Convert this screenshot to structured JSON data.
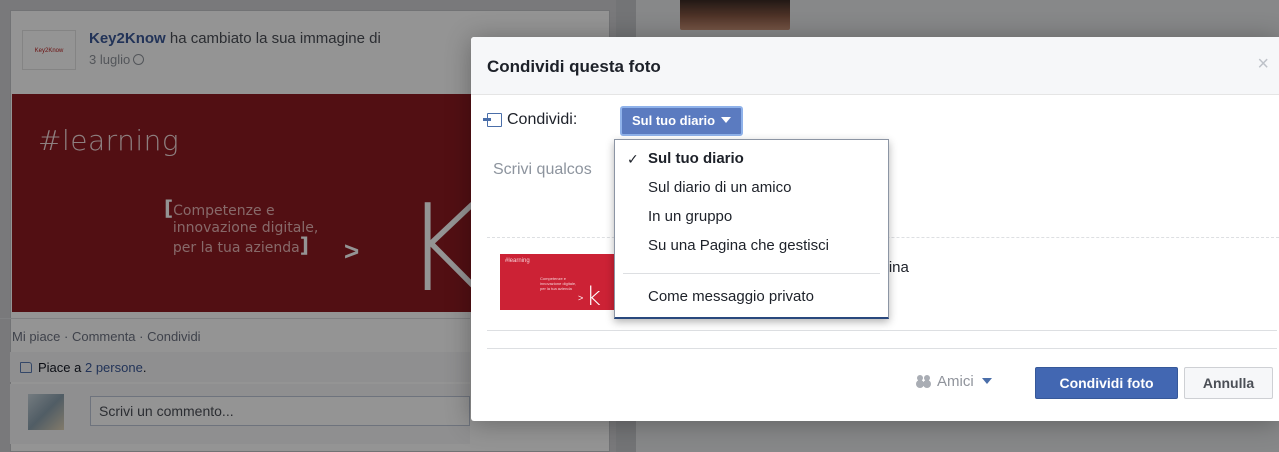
{
  "feed": {
    "page_logo_text": "Key2Know",
    "page_name": "Key2Know",
    "story_action": " ha cambiato la sua immagine di",
    "story_date": "3 luglio",
    "banner_hashtag": "#learning",
    "banner_tagline_line1": "Competenze e",
    "banner_tagline_line2": "innovazione digitale,",
    "banner_tagline_line3": "per la tua azienda",
    "banner_arrow": ">",
    "banner_k": "K",
    "actions_text": "Mi piace · Commenta · Condividi",
    "likes_prefix": "Piace a ",
    "likes_count": "2 persone",
    "likes_suffix": ".",
    "comment_placeholder": "Scrivi un commento..."
  },
  "dialog": {
    "title": "Condividi questa foto",
    "close_symbol": "×",
    "share_label": "Condividi:",
    "target_selected": "Sul tuo diario",
    "message_placeholder": "Scrivi qualcos",
    "preview_caption": "pertina",
    "preview_mini_hashtag": "#learning",
    "preview_mini_tagline": "Competenze e innovazione digitale, per la tua azienda",
    "preview_mini_arrow": ">",
    "preview_mini_k": "k",
    "audience_label": "Amici",
    "share_button": "Condividi foto",
    "cancel_button": "Annulla"
  },
  "target_menu": {
    "items": [
      {
        "label": "Sul tuo diario",
        "selected": true,
        "check": "✓"
      },
      {
        "label": "Sul diario di un amico",
        "selected": false
      },
      {
        "label": "In un gruppo",
        "selected": false
      },
      {
        "label": "Su una Pagina che gestisci",
        "selected": false
      },
      {
        "label": "Come messaggio privato",
        "selected": false
      }
    ]
  },
  "colors": {
    "facebook_blue": "#4267b2",
    "selector_blue": "#5b7bc0",
    "banner_red": "#8d1a22",
    "link_blue": "#3b5998"
  },
  "icons": [
    "globe-icon",
    "thumb-up-icon",
    "share-icon",
    "chevron-down-icon",
    "close-icon",
    "check-icon",
    "friends-icon"
  ]
}
